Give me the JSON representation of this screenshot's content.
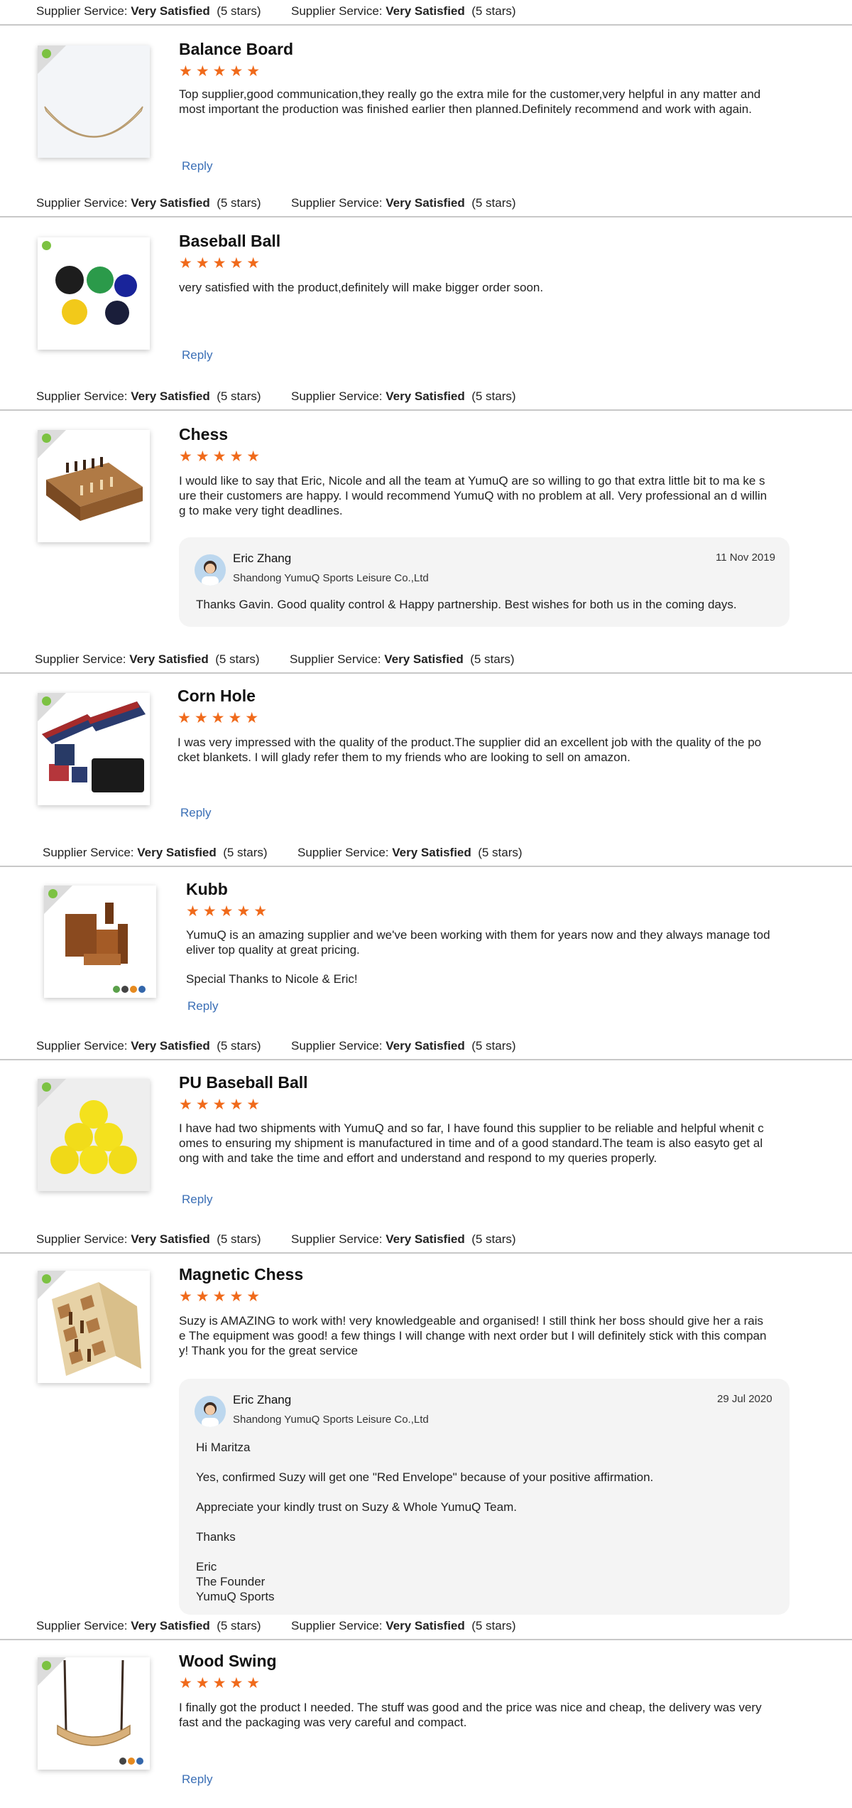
{
  "ratings_line": {
    "label": "Supplier Service:",
    "value": "Very Satisfied",
    "stars_text": "(5 stars)"
  },
  "reviews": [
    {
      "title": "Balance Board",
      "stars": "★★★★★",
      "text": [
        "Top supplier,good communication,they really go the extra mile for the customer,very helpful in any matter and most important the production was finished earlier then planned.Definitely recommend and work with again."
      ],
      "reply": "Reply",
      "image_icon": "balance-board-image"
    },
    {
      "title": "Baseball Ball",
      "stars": "★★★★★",
      "text": [
        "very satisfied with the product,definitely will make bigger order soon."
      ],
      "reply": "Reply",
      "image_icon": "baseball-balls-image"
    },
    {
      "title": "Chess",
      "stars": "★★★★★",
      "text": [
        "I would like to say that Eric, Nicole and all the team at YumuQ are so willing to go that extra little bit to ma ke sure their customers are happy. I would recommend YumuQ with no problem at all. Very professional an d willing to make very tight deadlines."
      ],
      "image_icon": "chess-board-image",
      "response": {
        "name": "Eric Zhang",
        "company": "Shandong YumuQ Sports Leisure Co.,Ltd",
        "date": "11 Nov 2019",
        "message": [
          "Thanks Gavin. Good quality control & Happy partnership. Best wishes for both us in the coming days."
        ]
      }
    },
    {
      "title": "Corn Hole",
      "stars": "★★★★★",
      "text": [
        "I was very impressed with the quality of the product.The supplier did an excellent job with the quality of the pocket blankets. I will glady refer them to my friends who are looking to sell on amazon."
      ],
      "reply": "Reply",
      "image_icon": "cornhole-boards-image"
    },
    {
      "title": "Kubb",
      "stars": "★★★★★",
      "text": [
        "YumuQ is an amazing supplier and we've been working with them for years now and they always manage todeliver top quality at great pricing.",
        "Special Thanks to Nicole & Eric!"
      ],
      "reply": "Reply",
      "image_icon": "kubb-set-image"
    },
    {
      "title": "PU Baseball Ball",
      "stars": "★★★★★",
      "text": [
        "I have had two shipments with YumuQ and so far, I have found this supplier to be reliable and helpful whenit comes to ensuring my shipment is manufactured in time and of a good standard.The team is also easyto get along with and take the time and effort and understand and respond to my queries properly."
      ],
      "reply": "Reply",
      "image_icon": "yellow-balls-image"
    },
    {
      "title": "Magnetic Chess",
      "stars": "★★★★★",
      "text": [
        "Suzy is AMAZING to work with! very knowledgeable and organised! I still think her boss should give her a raise  The equipment was good! a few things I will change with next order but I will definitely stick with this company! Thank you for the great service"
      ],
      "image_icon": "magnetic-chess-image",
      "response": {
        "name": "Eric Zhang",
        "company": "Shandong YumuQ Sports Leisure Co.,Ltd",
        "date": "29 Jul 2020",
        "message": [
          "Hi Maritza",
          "Yes, confirmed Suzy will get one \"Red Envelope\" because of your positive affirmation.",
          "Appreciate your kindly trust on Suzy & Whole YumuQ Team.",
          "Thanks",
          "Eric\nThe Founder\nYumuQ Sports"
        ]
      }
    },
    {
      "title": "Wood Swing",
      "stars": "★★★★★",
      "text": [
        "I finally got the product I needed. The stuff was good and the price was nice and cheap, the delivery was very fast and the packaging was very careful and compact."
      ],
      "reply": "Reply",
      "image_icon": "wood-swing-image"
    }
  ]
}
